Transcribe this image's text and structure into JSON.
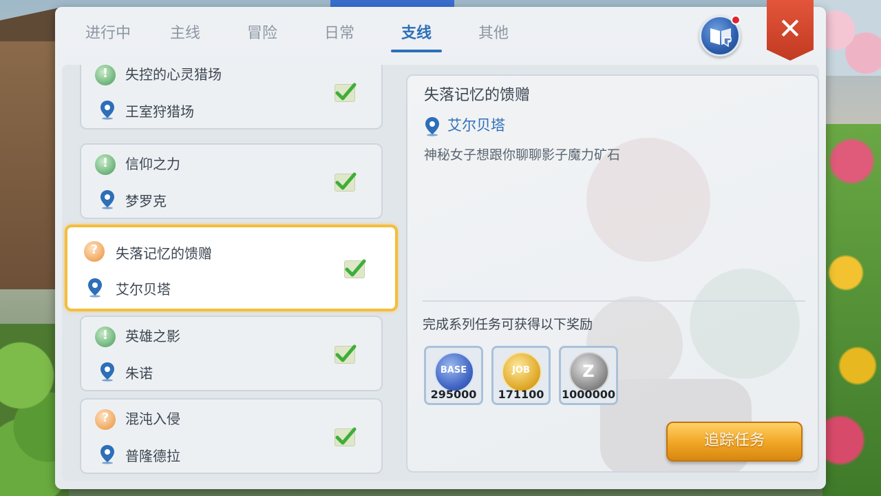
{
  "tabs": [
    {
      "label": "进行中"
    },
    {
      "label": "主线"
    },
    {
      "label": "冒险"
    },
    {
      "label": "日常"
    },
    {
      "label": "支线",
      "active": true
    },
    {
      "label": "其他"
    }
  ],
  "close_label": "✕",
  "quests": [
    {
      "title": "失控的心灵猎场",
      "location": "王室狩猎场",
      "icon": "green-quest-icon",
      "completed": true
    },
    {
      "title": "信仰之力",
      "location": "梦罗克",
      "icon": "green-quest-icon",
      "completed": true
    },
    {
      "title": "失落记忆的馈赠",
      "location": "艾尔贝塔",
      "icon": "orange-quest-icon",
      "completed": true,
      "selected": true
    },
    {
      "title": "英雄之影",
      "location": "朱诺",
      "icon": "green-quest-icon",
      "completed": true
    },
    {
      "title": "混沌入侵",
      "location": "普隆德拉",
      "icon": "orange-quest-icon",
      "completed": true
    }
  ],
  "detail": {
    "title": "失落记忆的馈赠",
    "location": "艾尔贝塔",
    "description": "神秘女子想跟你聊聊影子魔力矿石",
    "reward_label": "完成系列任务可获得以下奖励",
    "rewards": [
      {
        "type": "BASE",
        "amount": "295000"
      },
      {
        "type": "JOB",
        "amount": "171100"
      },
      {
        "type": "Z",
        "amount": "1000000"
      }
    ],
    "track_button": "追踪任务"
  },
  "colors": {
    "accent": "#2d6fb8",
    "selected_border": "#f5bd3c",
    "button_orange": "#f0a524",
    "close_red": "#c23a22"
  }
}
